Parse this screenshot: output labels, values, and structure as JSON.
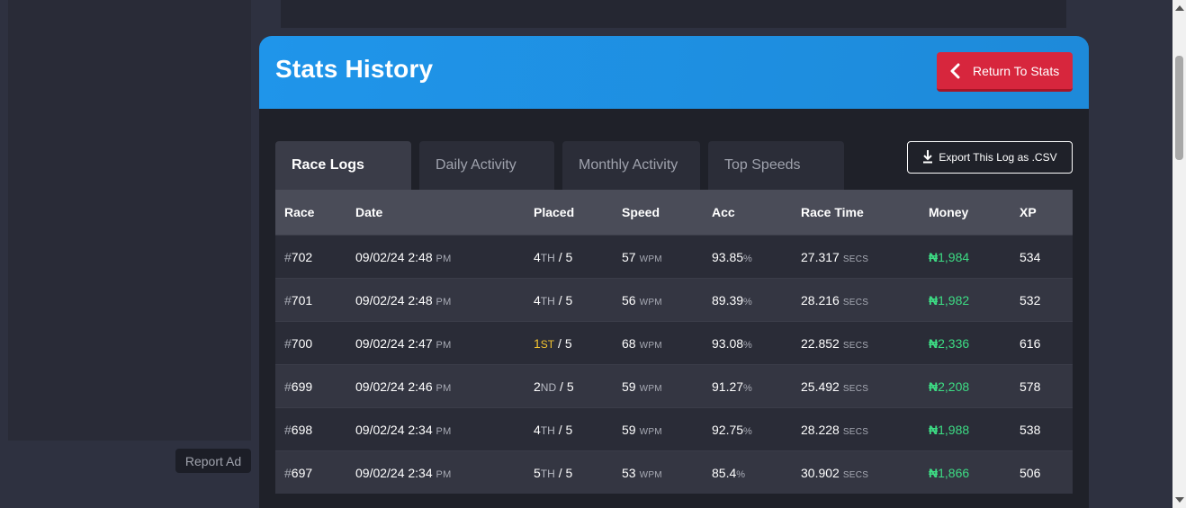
{
  "ad": {
    "report_label": "Report Ad"
  },
  "header": {
    "title": "Stats History",
    "return_label": "Return To Stats"
  },
  "tabs": [
    {
      "label": "Race Logs",
      "active": true
    },
    {
      "label": "Daily Activity",
      "active": false
    },
    {
      "label": "Monthly Activity",
      "active": false
    },
    {
      "label": "Top Speeds",
      "active": false
    }
  ],
  "export": {
    "label": "Export This Log as .CSV"
  },
  "table": {
    "columns": [
      "Race",
      "Date",
      "Placed",
      "Speed",
      "Acc",
      "Race Time",
      "Money",
      "XP"
    ],
    "rows": [
      {
        "race": "702",
        "date": "09/02/24 2:48",
        "ampm": "PM",
        "place": "4",
        "suffix": "TH",
        "total": "5",
        "speed": "57",
        "acc": "93.85",
        "time": "27.317",
        "money": "1,984",
        "xp": "534"
      },
      {
        "race": "701",
        "date": "09/02/24 2:48",
        "ampm": "PM",
        "place": "4",
        "suffix": "TH",
        "total": "5",
        "speed": "56",
        "acc": "89.39",
        "time": "28.216",
        "money": "1,982",
        "xp": "532"
      },
      {
        "race": "700",
        "date": "09/02/24 2:47",
        "ampm": "PM",
        "place": "1",
        "suffix": "ST",
        "total": "5",
        "speed": "68",
        "acc": "93.08",
        "time": "22.852",
        "money": "2,336",
        "xp": "616"
      },
      {
        "race": "699",
        "date": "09/02/24 2:46",
        "ampm": "PM",
        "place": "2",
        "suffix": "ND",
        "total": "5",
        "speed": "59",
        "acc": "91.27",
        "time": "25.492",
        "money": "2,208",
        "xp": "578"
      },
      {
        "race": "698",
        "date": "09/02/24 2:34",
        "ampm": "PM",
        "place": "4",
        "suffix": "TH",
        "total": "5",
        "speed": "59",
        "acc": "92.75",
        "time": "28.228",
        "money": "1,988",
        "xp": "538"
      },
      {
        "race": "697",
        "date": "09/02/24 2:34",
        "ampm": "PM",
        "place": "5",
        "suffix": "TH",
        "total": "5",
        "speed": "53",
        "acc": "85.4",
        "time": "30.902",
        "money": "1,866",
        "xp": "506"
      }
    ],
    "units": {
      "race_prefix": "#",
      "speed": "WPM",
      "acc": "%",
      "time": "SECS",
      "money_symbol": "₦",
      "place_sep": "/"
    }
  },
  "colors": {
    "accent": "#1f95ea",
    "danger": "#d7263d",
    "money": "#3ddc84",
    "first_place": "#f4c430"
  },
  "icons": {
    "return": "chevron-left-icon",
    "export": "download-icon"
  }
}
